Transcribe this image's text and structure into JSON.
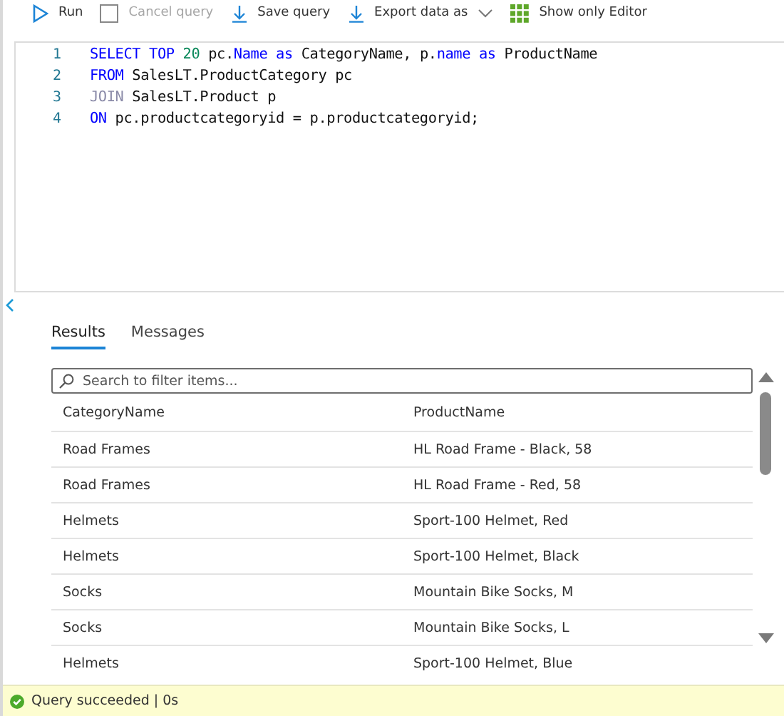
{
  "toolbar": [
    {
      "label": "Run",
      "disabled": false
    },
    {
      "label": "Cancel query",
      "disabled": true
    },
    {
      "label": "Save query",
      "disabled": false
    },
    {
      "label": "Export data as",
      "disabled": false,
      "dropdown": true
    },
    {
      "label": "Show only Editor",
      "disabled": false
    }
  ],
  "editor": {
    "lines": [
      {
        "number": "1",
        "tokens": [
          {
            "text": "SELECT TOP ",
            "kind": "keyword"
          },
          {
            "text": "20",
            "kind": "number"
          },
          {
            "text": " pc.",
            "kind": "plain"
          },
          {
            "text": "Name",
            "kind": "keyword"
          },
          {
            "text": " as",
            "kind": "keyword"
          },
          {
            "text": " CategoryName, p.",
            "kind": "plain"
          },
          {
            "text": "name",
            "kind": "keyword"
          },
          {
            "text": " as",
            "kind": "keyword"
          },
          {
            "text": " ProductName",
            "kind": "plain"
          }
        ]
      },
      {
        "number": "2",
        "tokens": [
          {
            "text": "FROM",
            "kind": "keyword"
          },
          {
            "text": " SalesLT.ProductCategory pc",
            "kind": "plain"
          }
        ]
      },
      {
        "number": "3",
        "tokens": [
          {
            "text": "JOIN",
            "kind": "operator"
          },
          {
            "text": " SalesLT.Product p",
            "kind": "plain"
          }
        ]
      },
      {
        "number": "4",
        "tokens": [
          {
            "text": "ON",
            "kind": "keyword"
          },
          {
            "text": " pc.productcategoryid = p.productcategoryid;",
            "kind": "plain"
          }
        ]
      }
    ]
  },
  "tabs": [
    {
      "label": "Results",
      "selected": true
    },
    {
      "label": "Messages",
      "selected": false
    }
  ],
  "search": {
    "placeholder": "Search to filter items..."
  },
  "table": {
    "columns": [
      "CategoryName",
      "ProductName"
    ],
    "rows": [
      [
        "Road Frames",
        "HL Road Frame - Black, 58"
      ],
      [
        "Road Frames",
        "HL Road Frame - Red, 58"
      ],
      [
        "Helmets",
        "Sport-100 Helmet, Red"
      ],
      [
        "Helmets",
        "Sport-100 Helmet, Black"
      ],
      [
        "Socks",
        "Mountain Bike Socks, M"
      ],
      [
        "Socks",
        "Mountain Bike Socks, L"
      ],
      [
        "Helmets",
        "Sport-100 Helmet, Blue"
      ]
    ]
  },
  "status_bar": {
    "text": "Query succeeded | 0s",
    "succeeded": true
  }
}
